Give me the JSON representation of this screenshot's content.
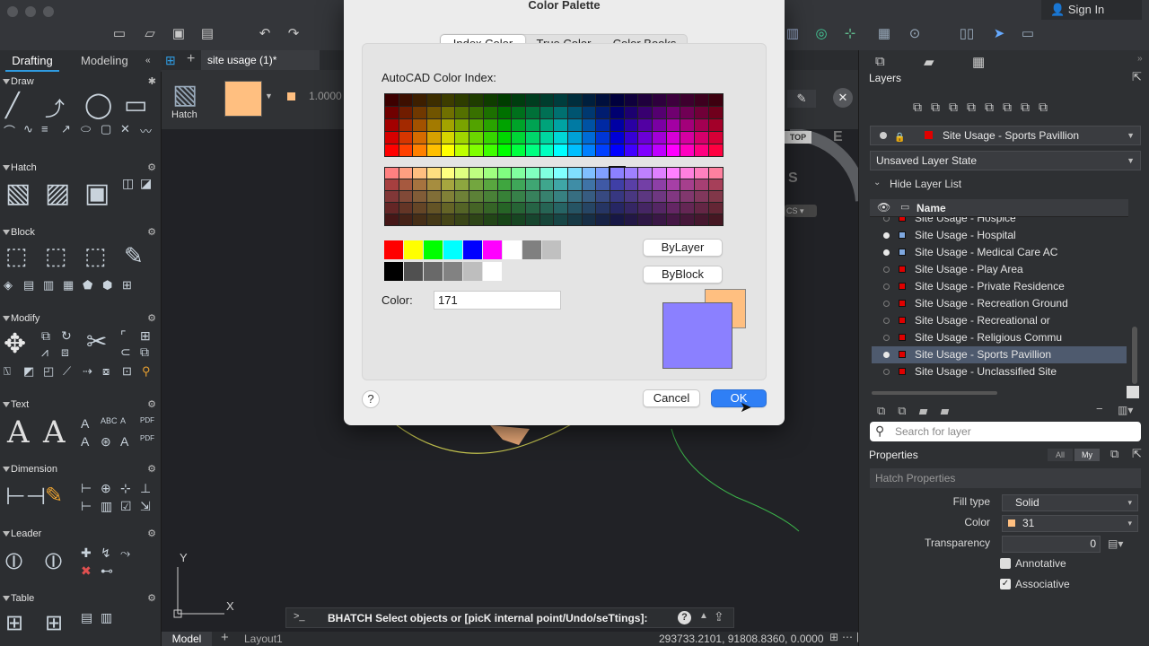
{
  "signin": "Sign In",
  "left": {
    "tabs": [
      "Drafting",
      "Modeling"
    ],
    "sections": [
      "Draw",
      "Hatch",
      "Block",
      "Modify",
      "Text",
      "Dimension",
      "Leader",
      "Table"
    ]
  },
  "doc": {
    "tab": "site usage (1)*",
    "model": "Model",
    "layout": "Layout1"
  },
  "ribbon": {
    "hatch_label": "Hatch",
    "scale": "1.0000",
    "stop": "TOP",
    "east": "E",
    "south": "S",
    "wcs": "CS"
  },
  "canvas": {
    "axis_y": "Y",
    "axis_x": "X"
  },
  "command": {
    "prompt": ">_",
    "text": "BHATCH Select objects or [picK internal point/Undo/seTtings]:"
  },
  "status": {
    "coords": "293733.2101, 91808.8360, 0.0000"
  },
  "dialog": {
    "title": "Color Palette",
    "tabs": [
      "Index Color",
      "True Color",
      "Color Books"
    ],
    "index_label": "AutoCAD Color Index:",
    "bylayer": "ByLayer",
    "byblock": "ByBlock",
    "color_label": "Color:",
    "color_value": "171",
    "help": "?",
    "cancel": "Cancel",
    "ok": "OK",
    "new_color": "#8b80ff",
    "old_color": "#ffbf80"
  },
  "layers": {
    "title": "Layers",
    "current_layer": "Site Usage - Sports Pavillion",
    "layer_state": "Unsaved Layer State",
    "hide_list": "Hide Layer List",
    "name_header": "Name",
    "items": [
      {
        "name": "Site Usage - Hospice",
        "on": false,
        "color": "#e00000"
      },
      {
        "name": "Site Usage - Hospital",
        "on": true,
        "color": "#7fa8e0"
      },
      {
        "name": "Site Usage - Medical Care AC",
        "on": true,
        "color": "#7fa8e0"
      },
      {
        "name": "Site Usage - Play Area",
        "on": false,
        "color": "#e00000"
      },
      {
        "name": "Site Usage - Private Residence",
        "on": false,
        "color": "#e00000"
      },
      {
        "name": "Site Usage - Recreation Ground",
        "on": false,
        "color": "#e00000"
      },
      {
        "name": "Site Usage - Recreational or",
        "on": false,
        "color": "#e00000"
      },
      {
        "name": "Site Usage - Religious Commu",
        "on": false,
        "color": "#e00000"
      },
      {
        "name": "Site Usage - Sports Pavillion",
        "on": true,
        "color": "#e00000",
        "selected": true
      },
      {
        "name": "Site Usage - Unclassified Site",
        "on": false,
        "color": "#e00000"
      }
    ],
    "search_placeholder": "Search for layer"
  },
  "properties": {
    "title": "Properties",
    "all": "All",
    "my": "My",
    "section": "Hatch Properties",
    "fill_type_label": "Fill type",
    "fill_type": "Solid",
    "color_label": "Color",
    "color": "31",
    "transparency_label": "Transparency",
    "transparency": "0",
    "annotative": "Annotative",
    "annotative_checked": false,
    "associative": "Associative",
    "associative_checked": true
  }
}
